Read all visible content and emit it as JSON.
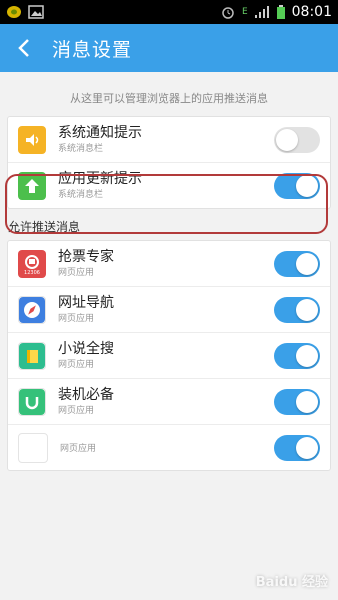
{
  "statusbar": {
    "time": "08:01",
    "network": "E"
  },
  "header": {
    "title": "消息设置"
  },
  "hint": "从这里可以管理浏览器上的应用推送消息",
  "system_items": [
    {
      "name": "系统通知提示",
      "sub": "系统消息栏",
      "icon": "speaker-icon",
      "color": "#f5b325",
      "on": false
    },
    {
      "name": "应用更新提示",
      "sub": "系统消息栏",
      "icon": "up-arrow-icon",
      "color": "#4cbf4c",
      "on": true
    }
  ],
  "section_title": "允许推送消息",
  "push_items": [
    {
      "name": "抢票专家",
      "sub": "网页应用",
      "icon": "train-icon",
      "color": "#e04a4a",
      "badge": "12306",
      "on": true
    },
    {
      "name": "网址导航",
      "sub": "网页应用",
      "icon": "compass-icon",
      "color": "#3e7fe0",
      "on": true
    },
    {
      "name": "小说全搜",
      "sub": "网页应用",
      "icon": "book-icon",
      "color": "#2dbd8f",
      "on": true
    },
    {
      "name": "装机必备",
      "sub": "网页应用",
      "icon": "magnet-icon",
      "color": "#35c17a",
      "on": true
    },
    {
      "name": "",
      "sub": "网页应用",
      "icon": "blank-app-icon",
      "color": "#ffffff",
      "on": true
    }
  ],
  "watermark": "Baidu 经验"
}
